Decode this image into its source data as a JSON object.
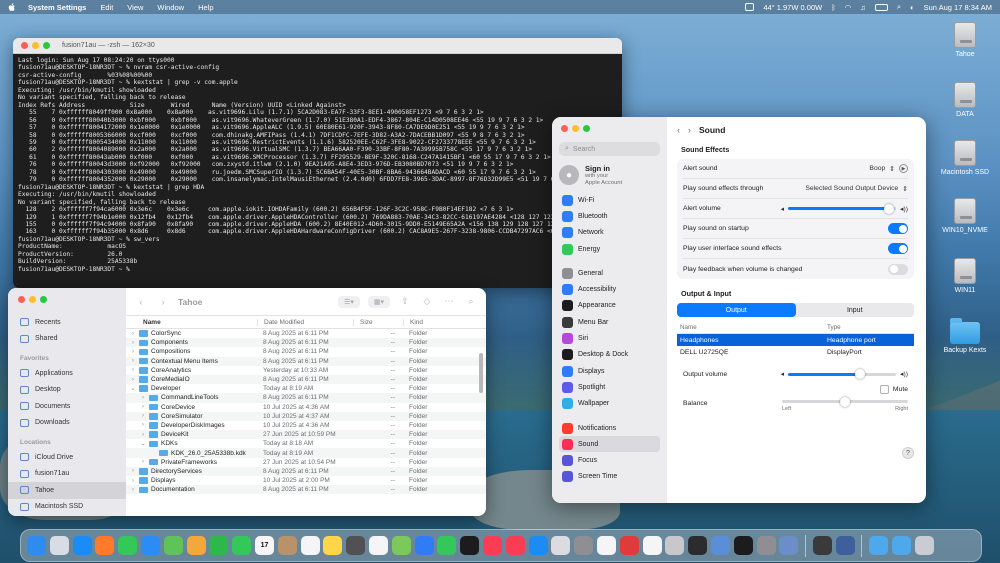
{
  "menubar": {
    "app_name": "System Settings",
    "items": [
      "Edit",
      "View",
      "Window",
      "Help"
    ],
    "stats": "44° 1.97W 0.00W",
    "clock": "Sun Aug 17  8:34 AM"
  },
  "desktop_icons": [
    {
      "label": "Tahoe",
      "type": "disk"
    },
    {
      "label": "DATA",
      "type": "disk"
    },
    {
      "label": "Macintosh SSD",
      "type": "disk"
    },
    {
      "label": "WIN10_NVME",
      "type": "disk"
    },
    {
      "label": "WIN11",
      "type": "disk"
    },
    {
      "label": "Backup Kexts",
      "type": "folder"
    }
  ],
  "terminal": {
    "title": "fusion71au — -zsh — 162×30",
    "lines": [
      "Last login: Sun Aug 17 08:24:20 on ttys000",
      "fusion71au@DESKTOP-18NR3DT ~ % nvram csr-active-config",
      "csr-active-config       %03%08%00%00",
      "fusion71au@DESKTOP-18NR3DT ~ % kextstat | grep -v com.apple",
      "Executing: /usr/bin/kmutil showloaded",
      "No variant specified, falling back to release",
      "Index Refs Address            Size       Wired      Name (Version) UUID <Linked Against>",
      "   55    7 0xffffff8049ff000 0x8a000    0x8a000    as.vit9696.Lilu (1.7.1) 5CA2D083-EA7F-33F3-8EE1-490058EF1273 <9 7 6 3 2 1>",
      "   56    0 0xffffff80040b3000 0xbf000    0xbf000    as.vit9696.WhateverGreen (1.7.0) 51E380A1-EDF4-3867-804E-C14D0508EE46 <55 19 9 7 6 3 2 1>",
      "   57    0 0xffffff8004172000 0x1e0000   0x1e0000   as.vit9696.AppleALC (1.9.5) 60E80E61-920F-3943-8F80-CA7DE9D0E251 <55 19 9 7 6 3 2 1>",
      "   58    0 0xffffff8005366000 0xcf000    0xcf000    com.dhinakg.AMFIPass (1.4.1) 7DF1CDFC-7EFE-3D82-A3A2-7DACEBB1D097 <55 9 8 7 6 3 2 1>",
      "   59    0 0xffffff8005434000 0x11000    0x11000    as.vit9696.RestrictEvents (1.1.6) 582520EE-C62F-3FE8-9022-CF2733778EEE <55 9 7 6 3 2 1>",
      "   60    2 0xffffff8004089000 0x2a000    0x2a000    as.vit9696.VirtualSMC (1.3.7) BEA66AA0-F390-33BF-8F80-7A39995B758C <55 17 9 7 6 3 2 1>",
      "   61    0 0xffffff80043ab000 0xf000     0xf000     as.vit9696.SMCProcessor (1.3.7) FF295529-8E9F-320C-8168-C247A1415BF1 <60 55 17 9 7 6 3 2 1>",
      "   76    0 0xffffff80043d3000 0xf92000   0xf92000   com.zxystd.itlwm (2.1.0) 9EA21A95-A8E4-3ED3-976D-EB3080BD7073 <51 19 9 7 6 3 2 1>",
      "   78    0 0xffffff8004303000 0x49000    0x49000    ru.joedm.SMCSuperIO (1.3.7) 5C6BA54F-40E5-30BF-8BA6-943664BADACD <60 55 17 9 7 6 3 2 1>",
      "   79    0 0xffffff8004352000 0x29000    0x29000    com.insanelymac.IntelMausiEthernet (2.4.0d0) 6FDD7FE8-3965-3DAC-8997-8F76D32D99E5 <51 19 7 6 3 2 1>",
      "fusion71au@DESKTOP-18NR3DT ~ % kextstat | grep HDA",
      "Executing: /usr/bin/kmutil showloaded",
      "No variant specified, falling back to release",
      "  128    2 0xffffff7f94ca6000 0x3e6c    0x3e6c     com.apple.iokit.IOHDAFamily (600.2) 656B4F5F-126F-3C2C-958C-F9B0F14EF182 <7 6 3 1>",
      "  129    1 0xffffff7f94b1e000 0x12fb4   0x12fb4    com.apple.driver.AppleHDAController (600.2) 769DA883-70AE-34C3-82CC-616197AE4284 <128 127 123 7 6 3 1>",
      "  155    0 0xffffff7f94c94000 0x8fa90   0x8fa90    com.apple.driver.AppleHDA (600.2) 8E40E012-4D60-3015-9DD0-E5149E65A2A <156 138 129 128 127 123 7 6 3 1>",
      "  163    0 0xffffff7f94b35000 0x8d6     0x8d6      com.apple.driver.AppleHDAHardwareConfigDriver (600.2) CAC8A9E5-267F-3238-9806-CCDB47297AC6 <6 3>",
      "fusion71au@DESKTOP-18NR3DT ~ % sw_vers",
      "ProductName:            macOS",
      "ProductVersion:         26.0",
      "BuildVersion:           25A5338b",
      "fusion71au@DESKTOP-18NR3DT ~ % "
    ]
  },
  "finder": {
    "title": "Tahoe",
    "sidebar": {
      "top": [
        "Recents",
        "Shared"
      ],
      "favorites_label": "Favorites",
      "favorites": [
        "Applications",
        "Desktop",
        "Documents",
        "Downloads"
      ],
      "locations_label": "Locations",
      "locations": [
        "iCloud Drive",
        "fusion71au",
        "Tahoe",
        "Macintosh SSD"
      ]
    },
    "columns": {
      "name": "Name",
      "date": "Date Modified",
      "size": "Size",
      "kind": "Kind"
    },
    "rows": [
      {
        "indent": 0,
        "arrow": "›",
        "name": "ColorSync",
        "date": "8 Aug 2025 at 6:11 PM",
        "size": "--",
        "kind": "Folder",
        "file": false
      },
      {
        "indent": 0,
        "arrow": "›",
        "name": "Components",
        "date": "8 Aug 2025 at 6:11 PM",
        "size": "--",
        "kind": "Folder",
        "file": false
      },
      {
        "indent": 0,
        "arrow": "›",
        "name": "Compositions",
        "date": "8 Aug 2025 at 6:11 PM",
        "size": "--",
        "kind": "Folder",
        "file": false
      },
      {
        "indent": 0,
        "arrow": "›",
        "name": "Contextual Menu Items",
        "date": "8 Aug 2025 at 6:11 PM",
        "size": "--",
        "kind": "Folder",
        "file": false
      },
      {
        "indent": 0,
        "arrow": "›",
        "name": "CoreAnalytics",
        "date": "Yesterday at 10:33 AM",
        "size": "--",
        "kind": "Folder",
        "file": false
      },
      {
        "indent": 0,
        "arrow": "›",
        "name": "CoreMediaIO",
        "date": "8 Aug 2025 at 6:11 PM",
        "size": "--",
        "kind": "Folder",
        "file": false
      },
      {
        "indent": 0,
        "arrow": "⌄",
        "name": "Developer",
        "date": "Today at 8:19 AM",
        "size": "--",
        "kind": "Folder",
        "file": false
      },
      {
        "indent": 1,
        "arrow": "›",
        "name": "CommandLineTools",
        "date": "8 Aug 2025 at 6:11 PM",
        "size": "--",
        "kind": "Folder",
        "file": false
      },
      {
        "indent": 1,
        "arrow": "›",
        "name": "CoreDevice",
        "date": "10 Jul 2025 at 4:36 AM",
        "size": "--",
        "kind": "Folder",
        "file": false
      },
      {
        "indent": 1,
        "arrow": "›",
        "name": "CoreSimulator",
        "date": "10 Jul 2025 at 4:37 AM",
        "size": "--",
        "kind": "Folder",
        "file": false
      },
      {
        "indent": 1,
        "arrow": "›",
        "name": "DeveloperDiskImages",
        "date": "10 Jul 2025 at 4:36 AM",
        "size": "--",
        "kind": "Folder",
        "file": false
      },
      {
        "indent": 1,
        "arrow": "›",
        "name": "DeviceKit",
        "date": "27 Jun 2025 at 10:59 PM",
        "size": "--",
        "kind": "Folder",
        "file": false
      },
      {
        "indent": 1,
        "arrow": "⌄",
        "name": "KDKs",
        "date": "Today at 8:18 AM",
        "size": "--",
        "kind": "Folder",
        "file": false
      },
      {
        "indent": 2,
        "arrow": "",
        "name": "KDK_26.0_25A5338b.kdk",
        "date": "Today at 8:19 AM",
        "size": "--",
        "kind": "Folder",
        "file": false
      },
      {
        "indent": 1,
        "arrow": "›",
        "name": "PrivateFrameworks",
        "date": "27 Jun 2025 at 10:54 PM",
        "size": "--",
        "kind": "Folder",
        "file": false
      },
      {
        "indent": 0,
        "arrow": "›",
        "name": "DirectoryServices",
        "date": "8 Aug 2025 at 6:11 PM",
        "size": "--",
        "kind": "Folder",
        "file": false
      },
      {
        "indent": 0,
        "arrow": "›",
        "name": "Displays",
        "date": "10 Jul 2025 at 2:00 PM",
        "size": "--",
        "kind": "Folder",
        "file": false
      },
      {
        "indent": 0,
        "arrow": "›",
        "name": "Documentation",
        "date": "8 Aug 2025 at 6:11 PM",
        "size": "--",
        "kind": "Folder",
        "file": false
      }
    ]
  },
  "settings": {
    "search_placeholder": "Search",
    "signin": {
      "title": "Sign in",
      "sub1": "with your",
      "sub2": "Apple Account"
    },
    "sidebar": [
      {
        "label": "Wi-Fi",
        "color": "#2f7cf6",
        "gap": false
      },
      {
        "label": "Bluetooth",
        "color": "#2f7cf6",
        "gap": false
      },
      {
        "label": "Network",
        "color": "#2f7cf6",
        "gap": false
      },
      {
        "label": "Energy",
        "color": "#34c759",
        "gap": false
      },
      {
        "label": "General",
        "color": "#8e8e93",
        "gap": true
      },
      {
        "label": "Accessibility",
        "color": "#2f7cf6",
        "gap": false
      },
      {
        "label": "Appearance",
        "color": "#1c1c1e",
        "gap": false
      },
      {
        "label": "Menu Bar",
        "color": "#3a3a3c",
        "gap": false
      },
      {
        "label": "Siri",
        "color": "#b34bd8",
        "gap": false
      },
      {
        "label": "Desktop & Dock",
        "color": "#1c1c1e",
        "gap": false
      },
      {
        "label": "Displays",
        "color": "#2f7cf6",
        "gap": false
      },
      {
        "label": "Spotlight",
        "color": "#5e5ce6",
        "gap": false
      },
      {
        "label": "Wallpaper",
        "color": "#32ade6",
        "gap": false
      },
      {
        "label": "Notifications",
        "color": "#ff3b30",
        "gap": true
      },
      {
        "label": "Sound",
        "color": "#ff2d55",
        "gap": false,
        "selected": true
      },
      {
        "label": "Focus",
        "color": "#5856d6",
        "gap": false
      },
      {
        "label": "Screen Time",
        "color": "#5856d6",
        "gap": false
      }
    ],
    "page_title": "Sound",
    "sound_effects": {
      "title": "Sound Effects",
      "alert_sound_label": "Alert sound",
      "alert_sound_value": "Boop",
      "play_through_label": "Play sound effects through",
      "play_through_value": "Selected Sound Output Device",
      "alert_volume_label": "Alert volume",
      "alert_volume": 0.98,
      "startup_label": "Play sound on startup",
      "startup_on": true,
      "ui_sounds_label": "Play user interface sound effects",
      "ui_sounds_on": true,
      "feedback_label": "Play feedback when volume is changed",
      "feedback_on": false
    },
    "output_input": {
      "title": "Output & Input",
      "tab_output": "Output",
      "tab_input": "Input",
      "col_name": "Name",
      "col_type": "Type",
      "devices": [
        {
          "name": "Headphones",
          "type": "Headphone port",
          "selected": true
        },
        {
          "name": "DELL U2725QE",
          "type": "DisplayPort",
          "selected": false
        }
      ],
      "output_volume_label": "Output volume",
      "output_volume": 0.68,
      "mute_label": "Mute",
      "balance_label": "Balance",
      "balance": 0.5,
      "left_label": "Left",
      "right_label": "Right"
    },
    "help": "?"
  },
  "dock": {
    "apps": [
      {
        "icon": "finder-icon",
        "color": "#2e8cf0"
      },
      {
        "icon": "launchpad-icon",
        "color": "#d8dce4"
      },
      {
        "icon": "safari-icon",
        "color": "#1b8cf5"
      },
      {
        "icon": "firefox-icon",
        "color": "#ff7b2a"
      },
      {
        "icon": "messages-icon",
        "color": "#34c759"
      },
      {
        "icon": "mail-icon",
        "color": "#2b8cf5"
      },
      {
        "icon": "maps-icon",
        "color": "#5fc35a"
      },
      {
        "icon": "photos-icon",
        "color": "#f2a83a"
      },
      {
        "icon": "facetime-icon",
        "color": "#2fb84a"
      },
      {
        "icon": "phone-icon",
        "color": "#34c759"
      },
      {
        "icon": "calendar-icon",
        "color": "#f5f5f7"
      },
      {
        "icon": "contacts-icon",
        "color": "#b7926a"
      },
      {
        "icon": "reminders-icon",
        "color": "#f5f5f7"
      },
      {
        "icon": "notes-icon",
        "color": "#ffd54a"
      },
      {
        "icon": "calculator-icon",
        "color": "#505055"
      },
      {
        "icon": "freeform-icon",
        "color": "#f5f5f7"
      },
      {
        "icon": "pencil-icon",
        "color": "#7cc85a"
      },
      {
        "icon": "keynote-icon",
        "color": "#2f7cf6"
      },
      {
        "icon": "numbers-icon",
        "color": "#34c759"
      },
      {
        "icon": "tv-icon",
        "color": "#1c1c1e"
      },
      {
        "icon": "music-icon",
        "color": "#fa3d54"
      },
      {
        "icon": "news-icon",
        "color": "#fa3d54"
      },
      {
        "icon": "appstore-icon",
        "color": "#1b8cf5"
      },
      {
        "icon": "simulator-icon",
        "color": "#dcdce0"
      },
      {
        "icon": "settings-icon",
        "color": "#8e8e93"
      },
      {
        "icon": "chrome-icon",
        "color": "#f5f5f7"
      },
      {
        "icon": "script-icon",
        "color": "#e03a3a"
      },
      {
        "icon": "preview-icon",
        "color": "#f5f5f7"
      },
      {
        "icon": "disk-utility-icon",
        "color": "#c7c7cc"
      },
      {
        "icon": "activity-monitor-icon",
        "color": "#2c2c2e"
      },
      {
        "icon": "console-icon",
        "color": "#5a8fd8"
      },
      {
        "icon": "terminal-icon",
        "color": "#1c1c1e"
      },
      {
        "icon": "hackintool-icon",
        "color": "#8e8e93"
      },
      {
        "icon": "ioreg-icon",
        "color": "#6b8ec9"
      }
    ],
    "right_apps": [
      {
        "icon": "opencore-icon",
        "color": "#3a3a3c"
      },
      {
        "icon": "shield-icon",
        "color": "#3f5f9c"
      }
    ],
    "folders": [
      {
        "icon": "folder-icon",
        "color": "#4ea8ec"
      },
      {
        "icon": "downloads-folder-icon",
        "color": "#4ea8ec"
      },
      {
        "icon": "trash-icon",
        "color": "#c9ccd2"
      }
    ],
    "calendar_day": "17"
  }
}
